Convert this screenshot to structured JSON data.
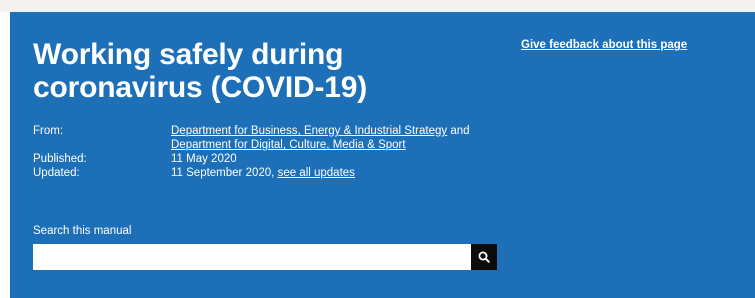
{
  "header": {
    "title": "Working safely during coronavirus (COVID-19)",
    "feedback_link": "Give feedback about this page"
  },
  "metadata": {
    "from_label": "From:",
    "from_org_1": "Department for Business, Energy & Industrial Strategy",
    "from_and": " and",
    "from_org_2": "Department for Digital, Culture, Media & Sport",
    "published_label": "Published:",
    "published_value": "11 May 2020",
    "updated_label": "Updated:",
    "updated_value": "11 September 2020, ",
    "updates_link": "see all updates"
  },
  "search": {
    "label": "Search this manual",
    "placeholder": "",
    "value": "",
    "button_icon": "search-icon"
  },
  "colors": {
    "banner": "#1d70b8",
    "text": "#ffffff",
    "search_button": "#0b0c0c",
    "top_strip": "#f3f2f1"
  }
}
